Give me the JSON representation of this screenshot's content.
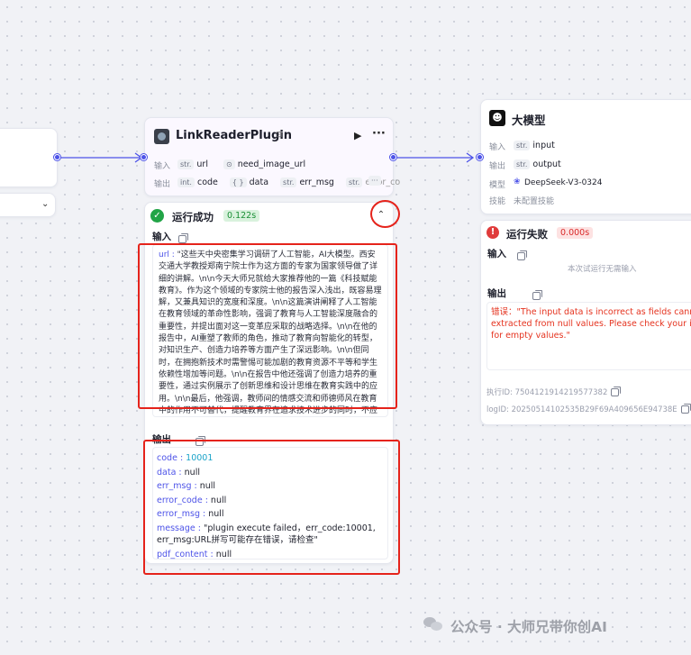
{
  "left_node": {},
  "link_node": {
    "title": "LinkReaderPlugin",
    "input_label": "输入",
    "output_label": "输出",
    "inputs": [
      {
        "type": "str.",
        "name": "url"
      },
      {
        "type": "⊙",
        "name": "need_image_url"
      }
    ],
    "outputs": [
      {
        "type": "int.",
        "name": "code"
      },
      {
        "type": "{ }",
        "name": "data"
      },
      {
        "type": "str.",
        "name": "err_msg"
      },
      {
        "type": "str.",
        "name": "error_co"
      }
    ],
    "more": "···"
  },
  "link_result": {
    "status": "运行成功",
    "time": "0.122s",
    "input_title": "输入",
    "input_key": "url",
    "input_text": "\"这些天中央密集学习调研了人工智能，AI大模型。西安交通大学教授郑南宁院士作为这方面的专家为国家领导做了详细的讲解。\\n\\n今天大师兄就给大家推荐他的一篇《科技赋能教育》。作为这个领域的专家院士他的报告深入浅出，既容易理解，又兼具知识的宽度和深度。\\n\\n这篇演讲阐释了人工智能在教育领域的革命性影响，强调了教育与人工智能深度融合的重要性，并提出面对这一变革应采取的战略选择。\\n\\n在他的报告中，AI重塑了教师的角色，推动了教育向智能化的转型，对知识生产、创造力培养等方面产生了深远影响。\\n\\n但同时，在拥抱新技术时需警惕可能加剧的教育资源不平等和学生依赖性增加等问题。\\n\\n在报告中他还强调了创造力培养的重要性，通过实例展示了创新思维和设计思维在教育实践中的应用。\\n\\n最后，他强调，教师间的情感交流和师德师风在教育中的作用不可替代，提醒教育界在追求技术进步的同时，不应忽视人与人之间深刻交流的教育核心价值。\"",
    "output_title": "输出",
    "outputs": [
      {
        "k": "code",
        "v": "10001"
      },
      {
        "k": "data",
        "v": "null"
      },
      {
        "k": "err_msg",
        "v": "null"
      },
      {
        "k": "error_code",
        "v": "null"
      },
      {
        "k": "error_msg",
        "v": "null"
      },
      {
        "k": "message",
        "v": "\"plugin execute failed，err_code:10001, err_msg:URL拼写可能存在错误，请检查\""
      },
      {
        "k": "pdf_content",
        "v": "null"
      }
    ]
  },
  "llm_node": {
    "title": "大模型",
    "input_label": "输入",
    "input_type": "str.",
    "input_name": "input",
    "output_label": "输出",
    "output_type": "str.",
    "output_name": "output",
    "model_label": "模型",
    "model_name": "DeepSeek-V3-0324",
    "skill_label": "技能",
    "skill_value": "未配置技能"
  },
  "llm_result": {
    "status": "运行失败",
    "time": "0.000s",
    "input_title": "输入",
    "input_empty": "本次试运行无需输入",
    "output_title": "输出",
    "error_text": "错误：\"The input data is incorrect as fields cannot be extracted from null values. Please check your input for empty values.\"",
    "exec_id": "执行ID: 7504121914219577382",
    "log_id": "logID: 20250514102535B29F69A409656E94738E"
  },
  "watermark": "公众号 · 大师兄带你创AI",
  "colors": {
    "accent": "#4d53e8",
    "success": "#1a8f35",
    "error": "#d92a2a",
    "highlight": "#e5231b"
  }
}
